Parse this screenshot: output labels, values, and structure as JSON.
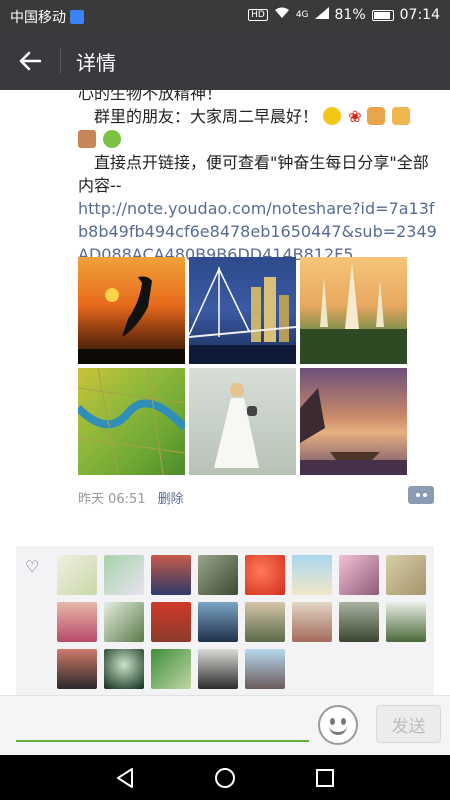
{
  "status_bar": {
    "carrier": "中国移动",
    "hd": "HD",
    "network": "4G",
    "battery": "81%",
    "time": "07:14"
  },
  "nav": {
    "title": "详情",
    "back_icon": "arrow-left-icon"
  },
  "post": {
    "line1": "心的生物不放精神！",
    "line2": "群里的朋友：大家周二早晨好！",
    "line3": "直接点开链接，便可查看\"钟奋生每日分享\"全部内容--",
    "link": "http://note.youdao.com/noteshare?id=7a13fb8b49fb494cf6e8478eb1650447&sub=2349AD088ACA480B9B6DD414B812F5",
    "images": [
      {
        "name": "sunset-crane"
      },
      {
        "name": "city-bridge-night"
      },
      {
        "name": "pagodas"
      },
      {
        "name": "river-fields"
      },
      {
        "name": "bride"
      },
      {
        "name": "boat-sunset"
      }
    ],
    "time": "昨天 06:51",
    "delete": "删除"
  },
  "likes": {
    "count": 20
  },
  "input": {
    "send": "发送"
  }
}
